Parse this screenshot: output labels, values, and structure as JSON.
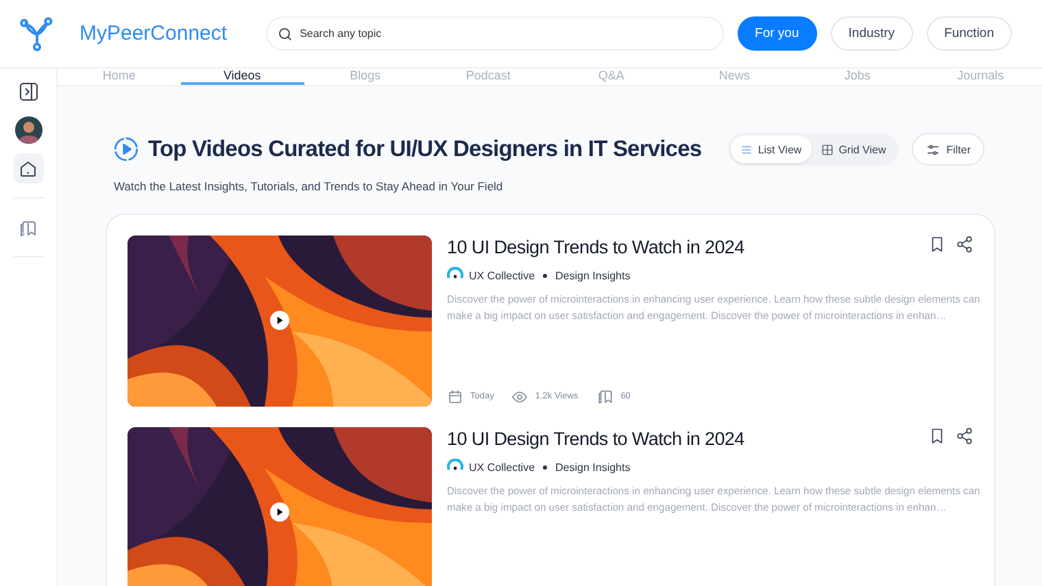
{
  "header": {
    "brand": "MyPeerConnect",
    "search": {
      "placeholder": "Search any topic"
    },
    "filters": [
      {
        "label": "For you",
        "selected": true
      },
      {
        "label": "Industry",
        "selected": false
      },
      {
        "label": "Function",
        "selected": false
      }
    ]
  },
  "sidebar": {
    "items": [
      {
        "kind": "toggle",
        "selected": false
      },
      {
        "kind": "avatar",
        "selected": false
      },
      {
        "kind": "home",
        "selected": true
      },
      {
        "kind": "library",
        "selected": false
      }
    ]
  },
  "tabs": [
    {
      "label": "Home",
      "selected": false
    },
    {
      "label": "Videos",
      "selected": true
    },
    {
      "label": "Blogs",
      "selected": false
    },
    {
      "label": "Podcast",
      "selected": false
    },
    {
      "label": "Q&A",
      "selected": false
    },
    {
      "label": "News",
      "selected": false
    },
    {
      "label": "Jobs",
      "selected": false
    },
    {
      "label": "Journals",
      "selected": false
    }
  ],
  "page": {
    "title": "Top Videos Curated for UI/UX Designers in IT Services",
    "subtitle": "Watch the Latest Insights, Tutorials, and Trends to Stay Ahead in Your Field",
    "views": [
      {
        "label": "List View",
        "selected": true
      },
      {
        "label": "Grid View",
        "selected": false
      }
    ],
    "filter": "Filter"
  },
  "videos": [
    {
      "kind": "picture",
      "title": "10 UI Design Trends to Watch in 2024",
      "source": "UX Collective",
      "category": "Design Insights",
      "description": "Discover the power of microinteractions in enhancing user experience. Learn how these subtle design elements can make a big impact on user satisfaction and engagement. Discover the power of microinteractions in enhan…",
      "date": "Today",
      "views": "1.2k Views",
      "count": "60"
    },
    {
      "kind": "picture",
      "title": "10 UI Design Trends to Watch in 2024",
      "source": "UX Collective",
      "category": "Design Insights",
      "description": "Discover the power of microinteractions in enhancing user experience. Learn how these subtle design elements can make a big impact on user satisfaction and engagement. Discover the power of microinteractions in enhan…"
    }
  ]
}
